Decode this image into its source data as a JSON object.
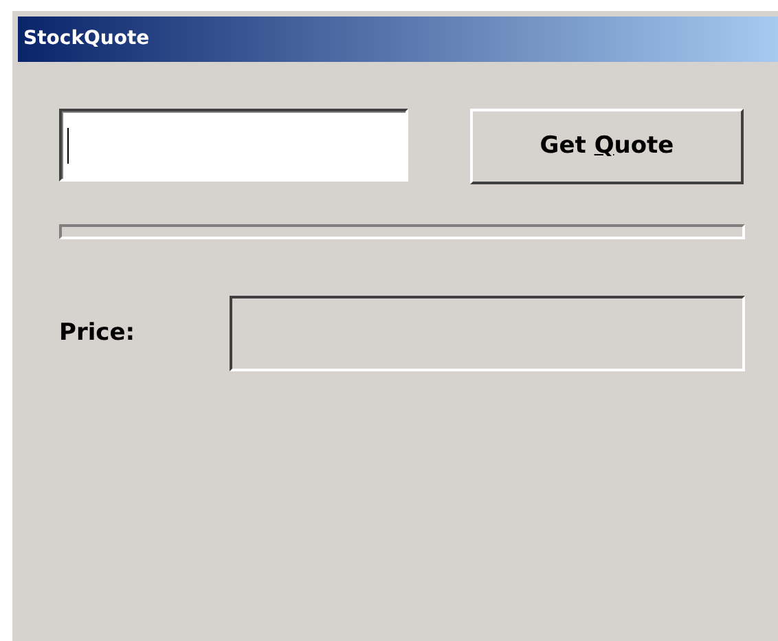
{
  "window": {
    "title": "StockQuote"
  },
  "symbol_field": {
    "focused": true
  },
  "quote_button": {
    "before": "Get ",
    "access_key": "Q",
    "after": "uote"
  },
  "progress": {
    "level": 0
  },
  "price": {
    "label": "Price:"
  }
}
